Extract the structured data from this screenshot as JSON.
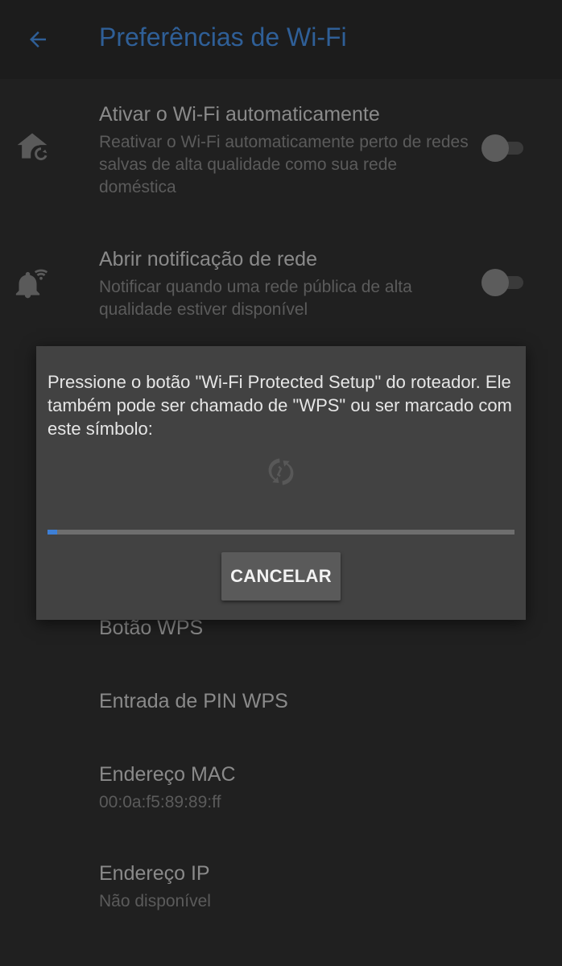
{
  "appbar": {
    "title": "Preferências de Wi-Fi",
    "back_icon": "arrow-back-icon",
    "accent_color": "#2f5f97"
  },
  "settings": {
    "auto_wifi": {
      "title": "Ativar o Wi-Fi automaticamente",
      "subtitle": "Reativar o Wi-Fi automaticamente perto de redes salvas de alta qualidade como sua rede doméstica",
      "icon": "home-refresh-icon",
      "enabled": false
    },
    "open_network_notification": {
      "title": "Abrir notificação de rede",
      "subtitle": "Notificar quando uma rede pública de alta qualidade estiver disponível",
      "icon": "notification-wifi-icon",
      "enabled": false
    },
    "wps_button": {
      "title": "Botão WPS"
    },
    "wps_pin": {
      "title": "Entrada de PIN WPS"
    },
    "mac_address": {
      "title": "Endereço MAC",
      "value": "00:0a:f5:89:89:ff"
    },
    "ip_address": {
      "title": "Endereço IP",
      "value": "Não disponível"
    }
  },
  "wps_dialog": {
    "message": "Pressione o botão \"Wi-Fi Protected Setup\" do roteador. Ele também pode ser chamado de \"WPS\" ou ser marcado com este símbolo:",
    "symbol_icon": "wps-icon",
    "progress_fraction": 0.02,
    "cancel_label": "CANCELAR"
  }
}
